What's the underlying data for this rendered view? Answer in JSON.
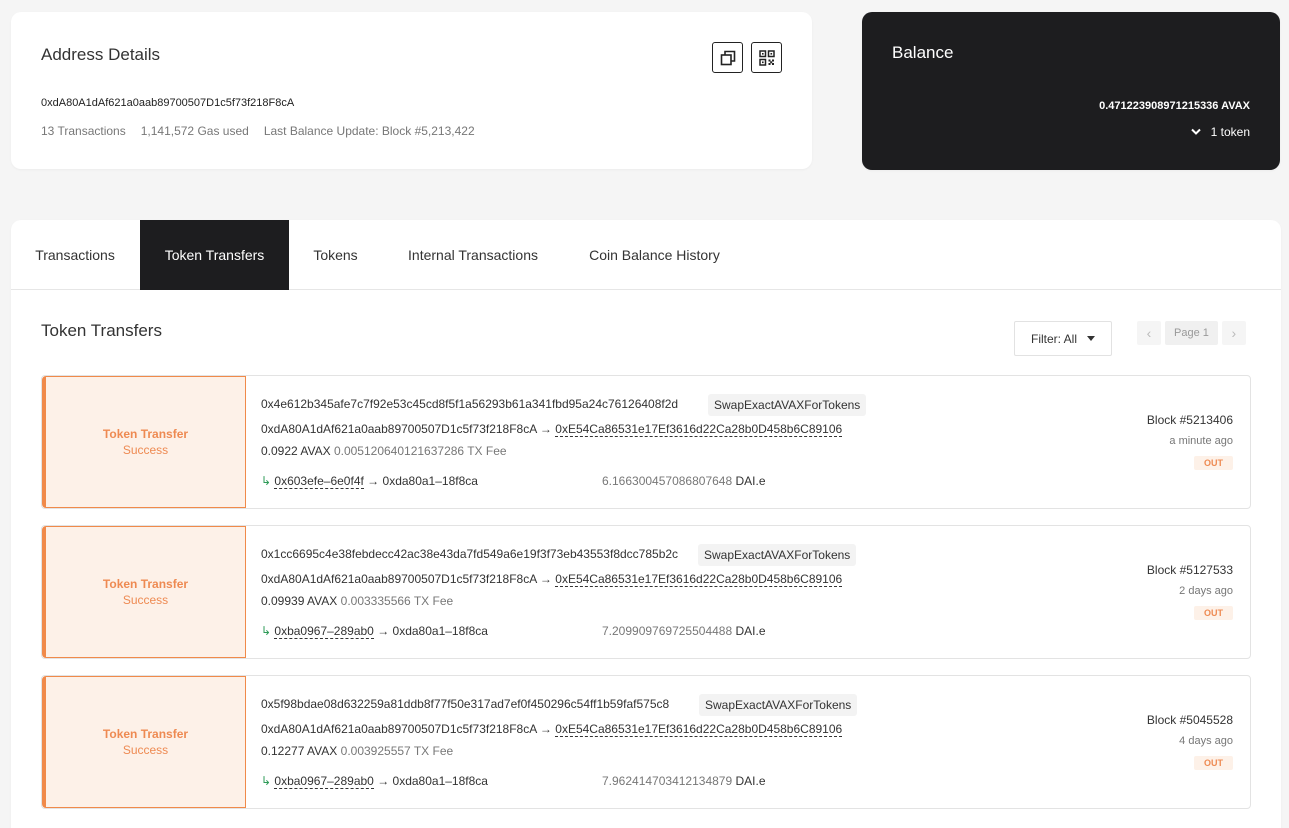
{
  "address_details": {
    "title": "Address Details",
    "address": "0xdA80A1dAf621a0aab89700507D1c5f73f218F8cA",
    "tx_count": "13 Transactions",
    "gas_used": "1,141,572 Gas used",
    "last_update": "Last Balance Update: Block #5,213,422",
    "copy_icon": "copy-icon",
    "qr_icon": "qr-code-icon"
  },
  "balance": {
    "title": "Balance",
    "amount": "0.471223908971215336 AVAX",
    "tokens_label": "1 token"
  },
  "tabs": [
    {
      "label": "Transactions",
      "active": false
    },
    {
      "label": "Token Transfers",
      "active": true
    },
    {
      "label": "Tokens",
      "active": false
    },
    {
      "label": "Internal Transactions",
      "active": false
    },
    {
      "label": "Coin Balance History",
      "active": false
    }
  ],
  "section": {
    "title": "Token Transfers",
    "filter_label": "Filter: All",
    "page_label": "Page 1"
  },
  "transfers": [
    {
      "type": "Token Transfer",
      "status": "Success",
      "hash": "0x4e612b345afe7c7f92e53c45cd8f5f1a56293b61a341fbd95a24c76126408f2d",
      "method": "SwapExactAVAXForTokens",
      "from": "0xdA80A1dAf621a0aab89700507D1c5f73f218F8cA",
      "to": "0xE54Ca86531e17Ef3616d22Ca28b0D458b6C89106",
      "value": "0.0922 AVAX",
      "fee": "0.005120640121637286 TX Fee",
      "sub_from": "0x603efe–6e0f4f",
      "sub_to": "0xda80a1–18f8ca",
      "token_amount": "6.166300457086807648",
      "token_symbol": "DAI.e",
      "block": "Block #5213406",
      "age": "a minute ago",
      "direction": "OUT"
    },
    {
      "type": "Token Transfer",
      "status": "Success",
      "hash": "0x1cc6695c4e38febdecc42ac38e43da7fd549a6e19f3f73eb43553f8dcc785b2c",
      "method": "SwapExactAVAXForTokens",
      "from": "0xdA80A1dAf621a0aab89700507D1c5f73f218F8cA",
      "to": "0xE54Ca86531e17Ef3616d22Ca28b0D458b6C89106",
      "value": "0.09939 AVAX",
      "fee": "0.003335566 TX Fee",
      "sub_from": "0xba0967–289ab0",
      "sub_to": "0xda80a1–18f8ca",
      "token_amount": "7.209909769725504488",
      "token_symbol": "DAI.e",
      "block": "Block #5127533",
      "age": "2 days ago",
      "direction": "OUT"
    },
    {
      "type": "Token Transfer",
      "status": "Success",
      "hash": "0x5f98bdae08d632259a81ddb8f77f50e317ad7ef0f450296c54ff1b59faf575c8",
      "method": "SwapExactAVAXForTokens",
      "from": "0xdA80A1dAf621a0aab89700507D1c5f73f218F8cA",
      "to": "0xE54Ca86531e17Ef3616d22Ca28b0D458b6C89106",
      "value": "0.12277 AVAX",
      "fee": "0.003925557 TX Fee",
      "sub_from": "0xba0967–289ab0",
      "sub_to": "0xda80a1–18f8ca",
      "token_amount": "7.962414703412134879",
      "token_symbol": "DAI.e",
      "block": "Block #5045528",
      "age": "4 days ago",
      "direction": "OUT"
    }
  ],
  "colors": {
    "accent": "#f08a4a",
    "dark": "#1d1d1f",
    "success_arrow": "#2e9b58"
  }
}
